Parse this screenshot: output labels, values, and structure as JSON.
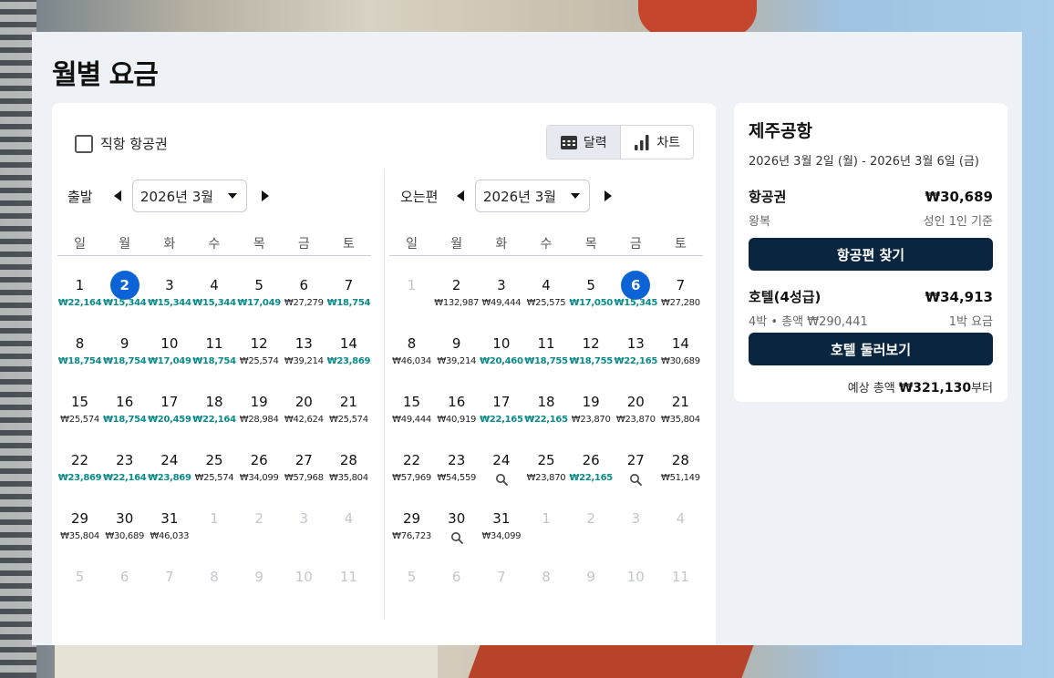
{
  "title": "월별 요금",
  "direct_flight_label": "직항 항공권",
  "view_toggle": {
    "calendar": "달력",
    "chart": "차트"
  },
  "departure": {
    "label": "출발",
    "month_select": "2026년 3월",
    "weekdays": [
      "일",
      "월",
      "화",
      "수",
      "목",
      "금",
      "토"
    ],
    "weeks": [
      [
        {
          "d": "1",
          "p": "₩22,164",
          "t": "teal"
        },
        {
          "d": "2",
          "p": "₩15,344",
          "t": "teal",
          "sel": true
        },
        {
          "d": "3",
          "p": "₩15,344",
          "t": "teal"
        },
        {
          "d": "4",
          "p": "₩15,344",
          "t": "teal"
        },
        {
          "d": "5",
          "p": "₩17,049",
          "t": "teal"
        },
        {
          "d": "6",
          "p": "₩27,279"
        },
        {
          "d": "7",
          "p": "₩18,754",
          "t": "teal"
        }
      ],
      [
        {
          "d": "8",
          "p": "₩18,754",
          "t": "teal"
        },
        {
          "d": "9",
          "p": "₩18,754",
          "t": "teal"
        },
        {
          "d": "10",
          "p": "₩17,049",
          "t": "teal"
        },
        {
          "d": "11",
          "p": "₩18,754",
          "t": "teal"
        },
        {
          "d": "12",
          "p": "₩25,574"
        },
        {
          "d": "13",
          "p": "₩39,214"
        },
        {
          "d": "14",
          "p": "₩23,869",
          "t": "teal"
        }
      ],
      [
        {
          "d": "15",
          "p": "₩25,574"
        },
        {
          "d": "16",
          "p": "₩18,754",
          "t": "teal"
        },
        {
          "d": "17",
          "p": "₩20,459",
          "t": "teal"
        },
        {
          "d": "18",
          "p": "₩22,164",
          "t": "teal"
        },
        {
          "d": "19",
          "p": "₩28,984"
        },
        {
          "d": "20",
          "p": "₩42,624"
        },
        {
          "d": "21",
          "p": "₩25,574"
        }
      ],
      [
        {
          "d": "22",
          "p": "₩23,869",
          "t": "teal"
        },
        {
          "d": "23",
          "p": "₩22,164",
          "t": "teal"
        },
        {
          "d": "24",
          "p": "₩23,869",
          "t": "teal"
        },
        {
          "d": "25",
          "p": "₩25,574"
        },
        {
          "d": "26",
          "p": "₩34,099"
        },
        {
          "d": "27",
          "p": "₩57,968"
        },
        {
          "d": "28",
          "p": "₩35,804"
        }
      ],
      [
        {
          "d": "29",
          "p": "₩35,804"
        },
        {
          "d": "30",
          "p": "₩30,689"
        },
        {
          "d": "31",
          "p": "₩46,033"
        },
        {
          "d": "1",
          "m": true
        },
        {
          "d": "2",
          "m": true
        },
        {
          "d": "3",
          "m": true
        },
        {
          "d": "4",
          "m": true
        }
      ],
      [
        {
          "d": "5",
          "m": true
        },
        {
          "d": "6",
          "m": true
        },
        {
          "d": "7",
          "m": true
        },
        {
          "d": "8",
          "m": true
        },
        {
          "d": "9",
          "m": true
        },
        {
          "d": "10",
          "m": true
        },
        {
          "d": "11",
          "m": true
        }
      ]
    ]
  },
  "return": {
    "label": "오는편",
    "month_select": "2026년 3월",
    "weekdays": [
      "일",
      "월",
      "화",
      "수",
      "목",
      "금",
      "토"
    ],
    "weeks": [
      [
        {
          "d": "1",
          "m": true
        },
        {
          "d": "2",
          "p": "₩132,987"
        },
        {
          "d": "3",
          "p": "₩49,444"
        },
        {
          "d": "4",
          "p": "₩25,575"
        },
        {
          "d": "5",
          "p": "₩17,050",
          "t": "teal"
        },
        {
          "d": "6",
          "p": "₩15,345",
          "t": "teal",
          "sel": true
        },
        {
          "d": "7",
          "p": "₩27,280"
        }
      ],
      [
        {
          "d": "8",
          "p": "₩46,034"
        },
        {
          "d": "9",
          "p": "₩39,214"
        },
        {
          "d": "10",
          "p": "₩20,460",
          "t": "teal"
        },
        {
          "d": "11",
          "p": "₩18,755",
          "t": "teal"
        },
        {
          "d": "12",
          "p": "₩18,755",
          "t": "teal"
        },
        {
          "d": "13",
          "p": "₩22,165",
          "t": "teal"
        },
        {
          "d": "14",
          "p": "₩30,689"
        }
      ],
      [
        {
          "d": "15",
          "p": "₩49,444"
        },
        {
          "d": "16",
          "p": "₩40,919"
        },
        {
          "d": "17",
          "p": "₩22,165",
          "t": "teal"
        },
        {
          "d": "18",
          "p": "₩22,165",
          "t": "teal"
        },
        {
          "d": "19",
          "p": "₩23,870"
        },
        {
          "d": "20",
          "p": "₩23,870"
        },
        {
          "d": "21",
          "p": "₩35,804"
        }
      ],
      [
        {
          "d": "22",
          "p": "₩57,969"
        },
        {
          "d": "23",
          "p": "₩54,559"
        },
        {
          "d": "24",
          "search": true
        },
        {
          "d": "25",
          "p": "₩23,870"
        },
        {
          "d": "26",
          "p": "₩22,165",
          "t": "teal"
        },
        {
          "d": "27",
          "search": true
        },
        {
          "d": "28",
          "p": "₩51,149"
        }
      ],
      [
        {
          "d": "29",
          "p": "₩76,723"
        },
        {
          "d": "30",
          "search": true
        },
        {
          "d": "31",
          "p": "₩34,099"
        },
        {
          "d": "1",
          "m": true
        },
        {
          "d": "2",
          "m": true
        },
        {
          "d": "3",
          "m": true
        },
        {
          "d": "4",
          "m": true
        }
      ],
      [
        {
          "d": "5",
          "m": true
        },
        {
          "d": "6",
          "m": true
        },
        {
          "d": "7",
          "m": true
        },
        {
          "d": "8",
          "m": true
        },
        {
          "d": "9",
          "m": true
        },
        {
          "d": "10",
          "m": true
        },
        {
          "d": "11",
          "m": true
        }
      ]
    ]
  },
  "summary": {
    "destination": "제주공항",
    "dates": "2026년 3월 2일 (월) - 2026년 3월 6일 (금)",
    "flight": {
      "name": "항공권",
      "price": "₩30,689",
      "sub_left": "왕복",
      "sub_right": "성인 1인 기준",
      "button": "항공편 찾기"
    },
    "hotel": {
      "name": "호텔(4성급)",
      "price": "₩34,913",
      "sub_left": "4박 • 총액 ₩290,441",
      "sub_right": "1박 요금",
      "button": "호텔 둘러보기"
    },
    "total_prefix": "예상 총액",
    "total_amount": "₩321,130",
    "total_suffix": "부터"
  },
  "colors": {
    "accent": "#0b63d6",
    "teal": "#0a8a8a",
    "button": "#0a2540"
  }
}
